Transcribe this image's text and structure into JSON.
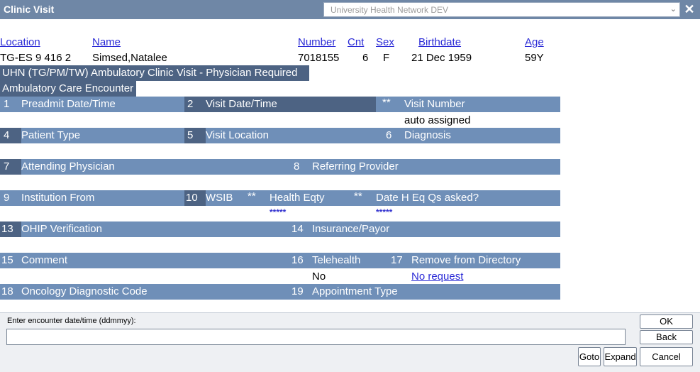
{
  "window": {
    "title": "Clinic Visit",
    "environment": "University Health Network DEV"
  },
  "patient_header": {
    "labels": {
      "location": "Location",
      "name": "Name",
      "number": "Number",
      "cnt": "Cnt",
      "sex": "Sex",
      "birthdate": "Birthdate",
      "age": "Age"
    },
    "values": {
      "location": "TG-ES 9 416 2",
      "name": "Simsed,Natalee",
      "number": "7018155",
      "cnt": "6",
      "sex": "F",
      "birthdate": "21 Dec 1959",
      "age": "59Y"
    }
  },
  "visit_type": "UHN (TG/PM/TW) Ambulatory Clinic Visit - Physician Required",
  "encounter_type": "Ambulatory Care Encounter",
  "fields": {
    "f1": {
      "num": "1",
      "label": "Preadmit Date/Time"
    },
    "f2": {
      "num": "2",
      "label": "Visit Date/Time"
    },
    "f3": {
      "num": "**",
      "label": "Visit Number",
      "value": "auto assigned"
    },
    "f4": {
      "num": "4",
      "label": "Patient Type"
    },
    "f5": {
      "num": "5",
      "label": "Visit Location"
    },
    "f6": {
      "num": "6",
      "label": "Diagnosis"
    },
    "f7": {
      "num": "7",
      "label": "Attending Physician"
    },
    "f8": {
      "num": "8",
      "label": "Referring Provider"
    },
    "f9": {
      "num": "9",
      "label": "Institution From"
    },
    "f10": {
      "num": "10",
      "label": "WSIB"
    },
    "f11": {
      "num": "**",
      "label": "Health Eqty",
      "value": "*****"
    },
    "f12": {
      "num": "**",
      "label": "Date H Eq Qs asked?",
      "value": "*****"
    },
    "f13": {
      "num": "13",
      "label": "OHIP Verification"
    },
    "f14": {
      "num": "14",
      "label": "Insurance/Payor"
    },
    "f15": {
      "num": "15",
      "label": "Comment"
    },
    "f16": {
      "num": "16",
      "label": "Telehealth",
      "value": "No"
    },
    "f17": {
      "num": "17",
      "label": "Remove from Directory",
      "value": "No request"
    },
    "f18": {
      "num": "18",
      "label": "Oncology Diagnostic Code"
    },
    "f19": {
      "num": "19",
      "label": "Appointment Type"
    }
  },
  "prompt": {
    "label": "Enter encounter date/time (ddmmyy):",
    "value": ""
  },
  "buttons": {
    "ok": "OK",
    "back": "Back",
    "goto": "Goto",
    "expand": "Expand",
    "cancel": "Cancel"
  },
  "icons": {
    "close": "close-icon",
    "dropdown": "chevron-down-icon"
  }
}
